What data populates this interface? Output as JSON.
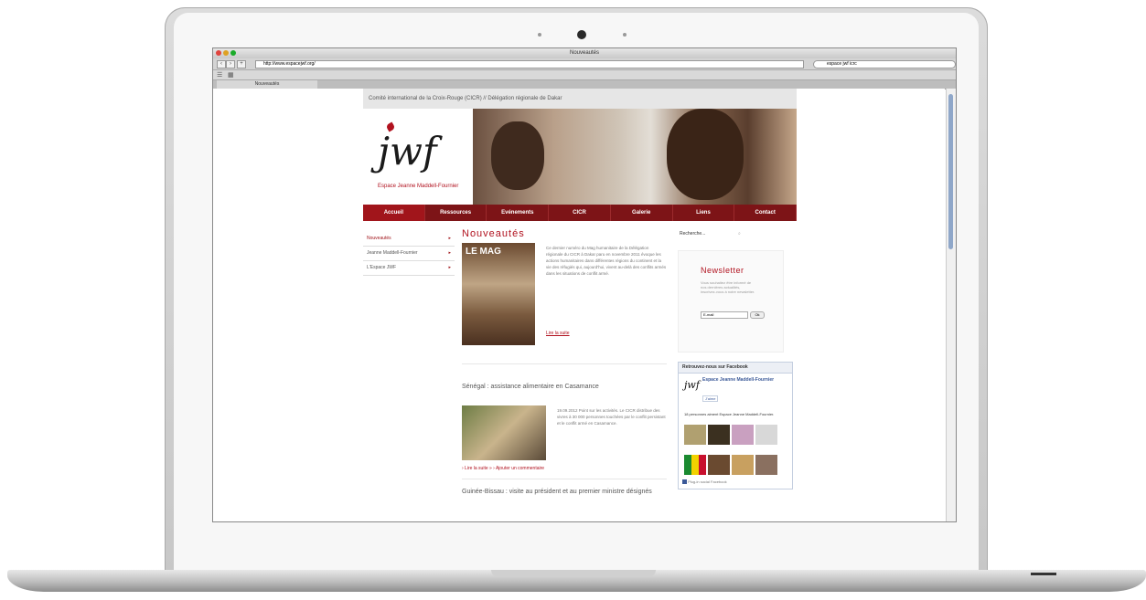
{
  "browser": {
    "window_title": "Nouveautés",
    "url": "http://www.espacejwf.org/",
    "search": "espace jwf icrc",
    "tab": "Nouveautés"
  },
  "site": {
    "topstrip": "Comité international de la Croix-Rouge (CICR) // Délégation régionale de Dakar",
    "logo_text": "jwf",
    "logo_sub": "Espace Jeanne Maddell-Fournier",
    "menu": [
      "Accueil",
      "Ressources",
      "Evénements",
      "CICR",
      "Galerie",
      "Liens",
      "Contact"
    ],
    "leftnav": [
      {
        "label": "Nouveautés",
        "active": true
      },
      {
        "label": "Jeanne Maddell-Fournier",
        "active": false
      },
      {
        "label": "L'Espace JWF",
        "active": false
      }
    ],
    "main": {
      "title": "Nouveautés",
      "mag_title": "LE MAG",
      "intro": "Ce dernier numéro du Mag humanitaire de la Délégation régionale du CICR à Dakar paru en novembre 2011 évoque les actions humanitaires dans différentes régions du continent et la vie des réfugiés qui, aujourd'hui, vivent au-delà des conflits armés dans les situations de conflit armé.",
      "read_more": "Lire la suite",
      "article2_title": "Sénégal : assistance alimentaire en Casamance",
      "article2_text": "19.09.2012 Point sur les activités. Le CICR distribue des vivres à 30 000 personnes touchées par le conflit persistant et le conflit armé en Casamance.",
      "article2_links": "› Lire la suite »   › Ajouter un commentaire",
      "article3_title": "Guinée-Bissau : visite au président et au premier ministre désignés"
    },
    "right": {
      "search_label": "Recherche...",
      "newsletter_title": "Newsletter",
      "newsletter_text": "Vous souhaitez être informé de nos dernières actualités, inscrivez-vous à notre newsletter.",
      "email_placeholder": "E-mail",
      "ok_label": "Ok",
      "fb_header": "Retrouvez-nous sur Facebook",
      "fb_name": "Espace Jeanne Maddell-Fournier",
      "fb_like": "J'aime",
      "fb_count": "18 personnes aiment Espace Jeanne Maddell-Fournier.",
      "fb_footer": "Plug-in social Facebook"
    }
  },
  "colors": {
    "brand_red": "#b1121f",
    "menu_dark": "#7d1417",
    "facebook_blue": "#3b5998"
  }
}
